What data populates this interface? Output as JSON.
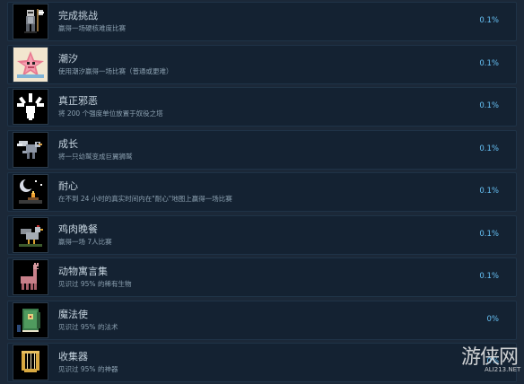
{
  "achievements": [
    {
      "title": "完成挑战",
      "description": "赢得一场硬核难度比赛",
      "percent": "0.1%",
      "icon": "knight-axe-icon"
    },
    {
      "title": "潮汐",
      "description": "使用潮汐赢得一场比赛（普通或更难）",
      "percent": "0.1%",
      "icon": "starfish-icon"
    },
    {
      "title": "真正邪恶",
      "description": "将 200 个强度单位放置于奴役之塔",
      "percent": "0.1%",
      "icon": "evil-splash-icon"
    },
    {
      "title": "成长",
      "description": "将一只幼鹫变成巨翼狮鹫",
      "percent": "0.1%",
      "icon": "griffin-icon"
    },
    {
      "title": "耐心",
      "description": "在不到 24 小时的真实时间内在\"耐心\"地图上赢得一场比赛",
      "percent": "0.1%",
      "icon": "moon-campfire-icon"
    },
    {
      "title": "鸡肉晚餐",
      "description": "赢得一场 7人比赛",
      "percent": "0.1%",
      "icon": "chicken-icon"
    },
    {
      "title": "动物寓言集",
      "description": "见识过 95% 的稀有生物",
      "percent": "0.1%",
      "icon": "llama-icon"
    },
    {
      "title": "魔法使",
      "description": "见识过 95% 的法术",
      "percent": "0%",
      "icon": "spellbook-icon"
    },
    {
      "title": "收集器",
      "description": "见识过 95% 的神器",
      "percent": "0%",
      "icon": "lyre-icon"
    }
  ],
  "watermark": {
    "text": "游侠网",
    "sub": "ALI213.NET"
  }
}
